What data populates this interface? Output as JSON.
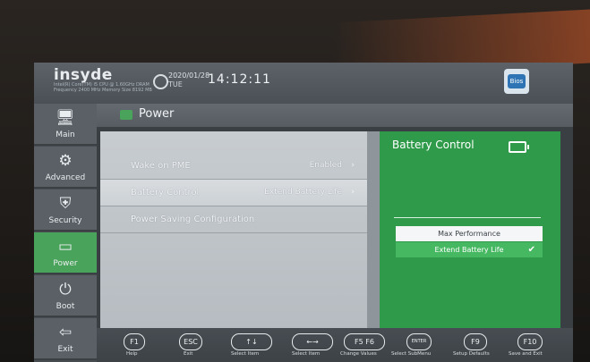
{
  "header": {
    "brand": "insyde",
    "brand_small": "Intel(R) Core(TM) i5 CPU @ 1.60GHz  DRAM Frequency 2400 MHz  Memory Size 8192 MB",
    "date": "2020/01/28",
    "day": "TUE",
    "time": "14:12:11",
    "logo": "Bios"
  },
  "sidebar": {
    "items": [
      {
        "label": "Main",
        "icon": "monitor-icon",
        "glyph": "🖥"
      },
      {
        "label": "Advanced",
        "icon": "advanced-icon",
        "glyph": "⚙"
      },
      {
        "label": "Security",
        "icon": "shield-icon",
        "glyph": "⛨"
      },
      {
        "label": "Power",
        "icon": "battery-icon",
        "glyph": "▭"
      },
      {
        "label": "Boot",
        "icon": "power-icon",
        "glyph": "⏻"
      },
      {
        "label": "Exit",
        "icon": "exit-icon",
        "glyph": "⇦"
      }
    ],
    "active": "Power"
  },
  "page": {
    "title": "Power"
  },
  "settings": [
    {
      "label": "Wake on PME",
      "value": "Enabled",
      "arrow": "›"
    },
    {
      "label": "Battery Control",
      "value": "Extend Battery Life",
      "arrow": "›"
    },
    {
      "label": "Power Saving Configuration",
      "value": "",
      "arrow": ""
    }
  ],
  "help": {
    "title": "Battery Control",
    "options": [
      "Max Performance",
      "Extend Battery Life"
    ],
    "selected": "Extend Battery Life",
    "check": "✔"
  },
  "footer": {
    "keys": [
      {
        "cap": "F1",
        "label": "Help"
      },
      {
        "cap": "ESC",
        "label": "Exit"
      },
      {
        "cap": "↑↓",
        "label": "Select Item"
      },
      {
        "cap": "←→",
        "label": "Select Item"
      },
      {
        "cap": "F5 F6",
        "label": "Change Values"
      },
      {
        "cap": "ENTER",
        "label": "Select  SubMenu"
      },
      {
        "cap": "F9",
        "label": "Setup Defaults"
      },
      {
        "cap": "F10",
        "label": "Save and Exit"
      }
    ]
  },
  "colors": {
    "accent_green": "#2f9b4a",
    "active_tab": "#4aa35a"
  }
}
